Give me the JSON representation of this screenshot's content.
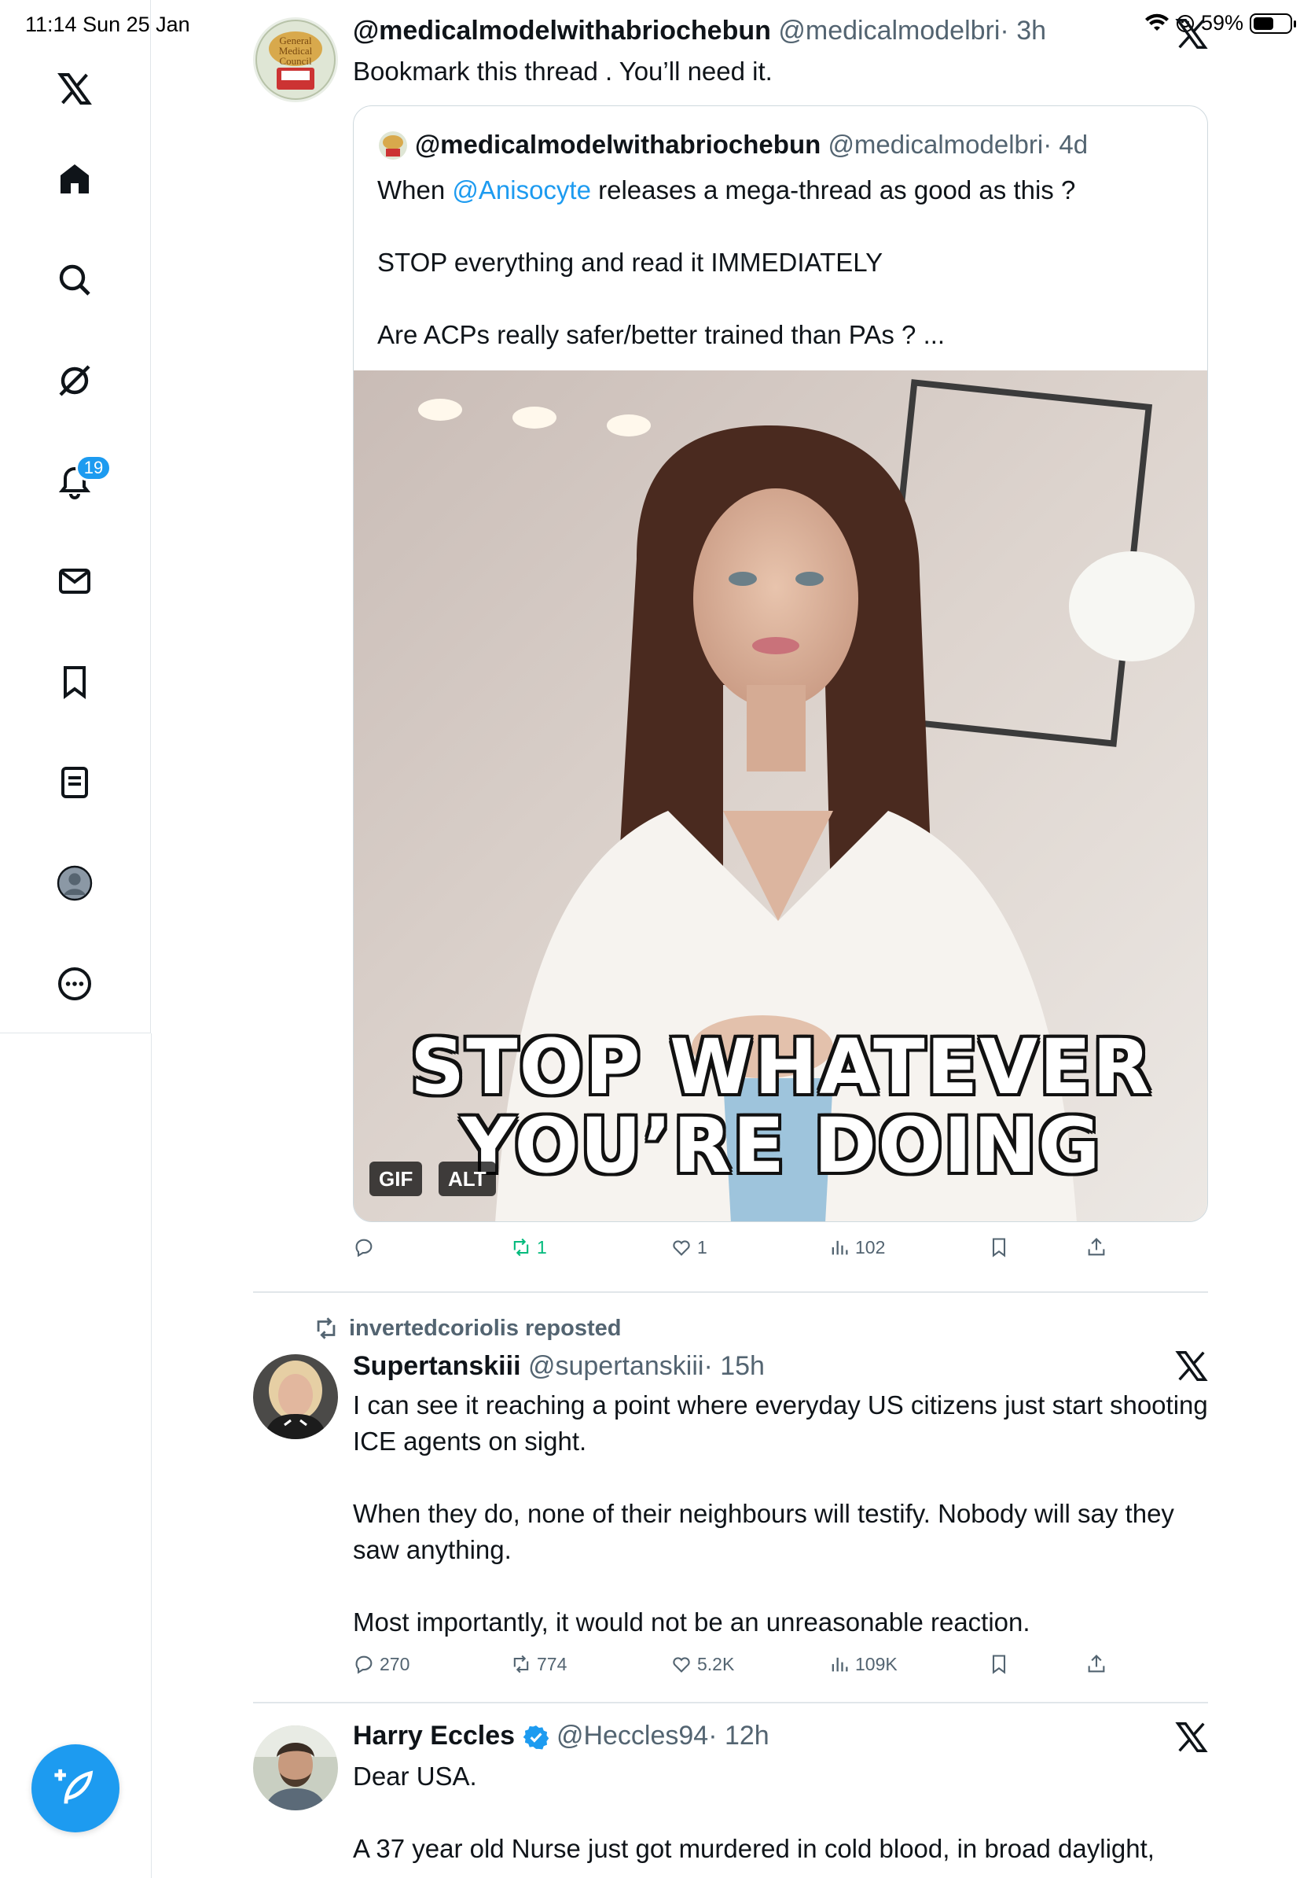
{
  "status_bar": {
    "time_date": "11:14  Sun 25 Jan",
    "battery": "59%",
    "battery_level": 0.56
  },
  "sidebar": {
    "items": [
      {
        "name": "x-logo"
      },
      {
        "name": "home"
      },
      {
        "name": "search"
      },
      {
        "name": "grok"
      },
      {
        "name": "notifications"
      },
      {
        "name": "messages"
      },
      {
        "name": "bookmarks"
      },
      {
        "name": "lists"
      },
      {
        "name": "profile"
      },
      {
        "name": "more"
      }
    ],
    "notification_count": "19"
  },
  "posts": [
    {
      "name": "@medicalmodelwithabriochebun",
      "handle": "@medicalmodelbri",
      "time": "· 3h",
      "text": "Bookmark this thread . You’ll need it.",
      "quote": {
        "name": "@medicalmodelwithabriochebun",
        "handle": "@medicalmodelbri",
        "time": "· 4d",
        "text_before": "When ",
        "mention": "@Anisocyte",
        "text_after": " releases a mega-thread as good as this ?",
        "line2": "STOP everything and read it IMMEDIATELY",
        "line3": "Are ACPs really safer/better trained than PAs ? ...",
        "gif_caption_1": "STOP WHATEVER",
        "gif_caption_2": "YOU’RE DOING",
        "tag_gif": "GIF",
        "tag_alt": "ALT"
      },
      "actions": {
        "reply": "",
        "repost": "1",
        "like": "1",
        "views": "102"
      }
    },
    {
      "repost_by": "invertedcoriolis reposted",
      "name": "Supertanskiii",
      "handle": "@supertanskiii",
      "time": "· 15h",
      "para1": "I can see it reaching a point where everyday US citizens just start shooting ICE agents on sight.",
      "para2": "When they do, none of their neighbours will testify. Nobody will say they saw anything.",
      "para3": "Most importantly, it would not be an unreasonable reaction.",
      "actions": {
        "reply": "270",
        "repost": "774",
        "like": "5.2K",
        "views": "109K"
      }
    },
    {
      "name": "Harry Eccles",
      "handle": "@Heccles94",
      "time": "· 12h",
      "para1": "Dear USA.",
      "para2": "A 37 year old Nurse just got murdered in cold blood, in broad daylight,"
    }
  ],
  "colors": {
    "accent": "#1d9bf0",
    "repost_green": "#00ba7c",
    "muted": "#536471"
  }
}
